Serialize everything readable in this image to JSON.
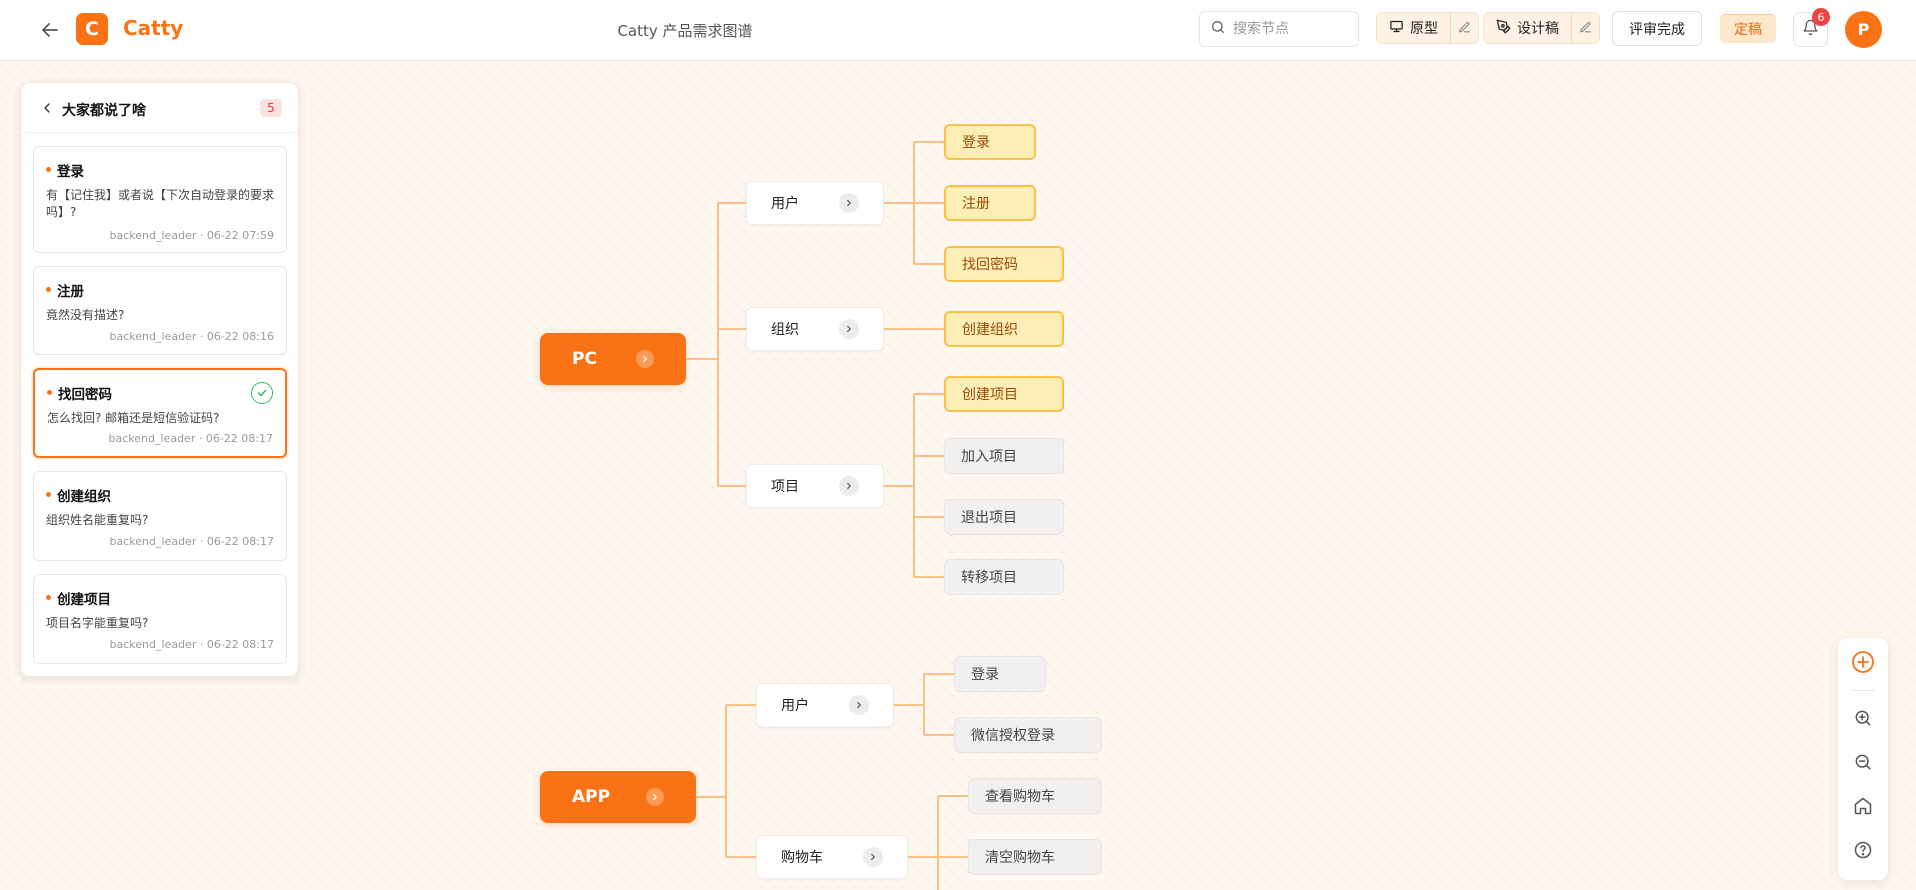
{
  "header": {
    "logo_letter": "C",
    "app_name": "Catty",
    "doc_title": "Catty 产品需求图谱",
    "search_placeholder": "搜索节点",
    "prototype_label": "原型",
    "design_label": "设计稿",
    "review_label": "评审完成",
    "finalize_label": "定稿",
    "notification_count": "6",
    "avatar_letter": "P"
  },
  "comments": {
    "title": "大家都说了啥",
    "count": "5",
    "items": [
      {
        "title": "登录",
        "body": "有【记住我】或者说【下次自动登录的要求吗】?",
        "meta": "backend_leader · 06-22 07:59",
        "resolved": false
      },
      {
        "title": "注册",
        "body": "竟然没有描述?",
        "meta": "backend_leader · 06-22 08:16",
        "resolved": false
      },
      {
        "title": "找回密码",
        "body": "怎么找回?  邮箱还是短信验证码?",
        "meta": "backend_leader · 06-22 08:17",
        "resolved": true
      },
      {
        "title": "创建组织",
        "body": "组织姓名能重复吗?",
        "meta": "backend_leader · 06-22 08:17",
        "resolved": false
      },
      {
        "title": "创建项目",
        "body": "项目名字能重复吗?",
        "meta": "backend_leader · 06-22 08:17",
        "resolved": false
      }
    ]
  },
  "mindmap": {
    "pc": {
      "label": "PC",
      "user": {
        "label": "用户",
        "children": [
          "登录",
          "注册",
          "找回密码"
        ]
      },
      "org": {
        "label": "组织",
        "children": [
          "创建组织"
        ]
      },
      "project": {
        "label": "项目",
        "children": [
          "创建项目",
          "加入项目",
          "退出项目",
          "转移项目"
        ]
      }
    },
    "app": {
      "label": "APP",
      "user": {
        "label": "用户",
        "children": [
          "登录",
          "微信授权登录"
        ]
      },
      "cart": {
        "label": "购物车",
        "children": [
          "查看购物车",
          "清空购物车"
        ]
      }
    }
  },
  "colors": {
    "accent": "#f97316",
    "connector": "#f8c084",
    "highlight_leaf_bg": "#fdeeb6",
    "highlight_leaf_border": "#f7c24a",
    "badge_red": "#ef4444",
    "resolved_green": "#2fb866"
  },
  "icons": [
    "back-arrow-icon",
    "search-icon",
    "monitor-icon",
    "pen-tool-icon",
    "edit-icon",
    "bell-icon",
    "chevron-right-icon",
    "check-icon",
    "plus-icon",
    "zoom-in-icon",
    "zoom-out-icon",
    "home-icon",
    "help-icon"
  ]
}
